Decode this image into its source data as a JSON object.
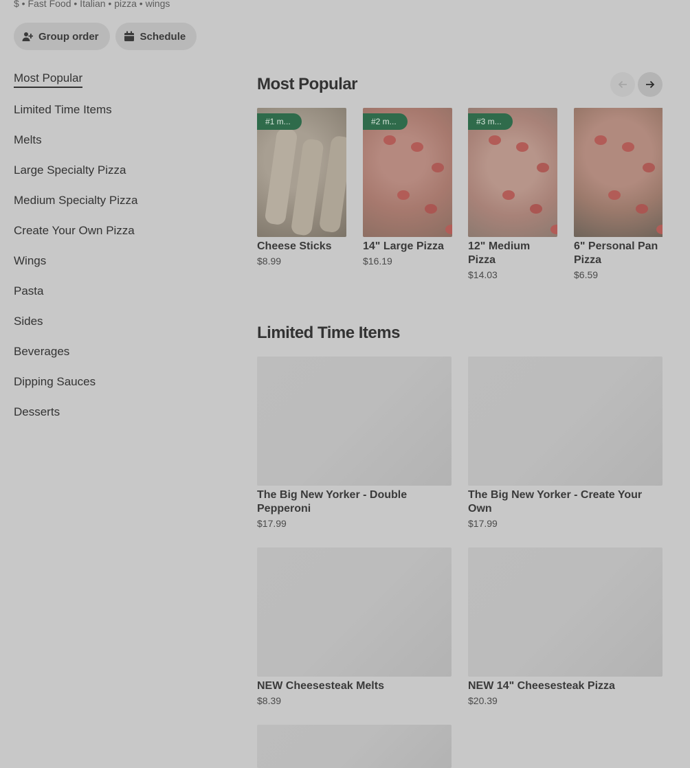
{
  "store": {
    "tags": "$ • Fast Food • Italian • pizza • wings"
  },
  "actions": {
    "group_order": "Group order",
    "schedule": "Schedule"
  },
  "sidebar": {
    "items": [
      {
        "label": "Most Popular"
      },
      {
        "label": "Limited Time Items"
      },
      {
        "label": "Melts"
      },
      {
        "label": "Large Specialty Pizza"
      },
      {
        "label": "Medium Specialty Pizza"
      },
      {
        "label": "Create Your Own Pizza"
      },
      {
        "label": "Wings"
      },
      {
        "label": "Pasta"
      },
      {
        "label": "Sides"
      },
      {
        "label": "Beverages"
      },
      {
        "label": "Dipping Sauces"
      },
      {
        "label": "Desserts"
      }
    ]
  },
  "most_popular": {
    "title": "Most Popular",
    "items": [
      {
        "badge": "#1 m...",
        "name": "Cheese Sticks",
        "price": "$8.99"
      },
      {
        "badge": "#2 m...",
        "name": "14\" Large Pizza",
        "price": "$16.19"
      },
      {
        "badge": "#3 m...",
        "name": "12\" Medium Pizza",
        "price": "$14.03"
      },
      {
        "name": "6\" Personal Pan Pizza",
        "price": "$6.59"
      }
    ]
  },
  "limited_time": {
    "title": "Limited Time Items",
    "items": [
      {
        "name": "The Big New Yorker - Double Pepperoni",
        "price": "$17.99"
      },
      {
        "name": "The Big New Yorker - Create Your Own",
        "price": "$17.99"
      },
      {
        "name": "NEW Cheesesteak Melts",
        "price": "$8.39"
      },
      {
        "name": "NEW 14\" Cheesesteak Pizza",
        "price": "$20.39"
      }
    ]
  },
  "icons": {
    "group_order": "person-add-icon",
    "schedule": "calendar-icon",
    "prev": "arrow-left-icon",
    "next": "arrow-right-icon"
  },
  "colors": {
    "badge": "#2f6b4b",
    "background": "#c8c8c8"
  }
}
